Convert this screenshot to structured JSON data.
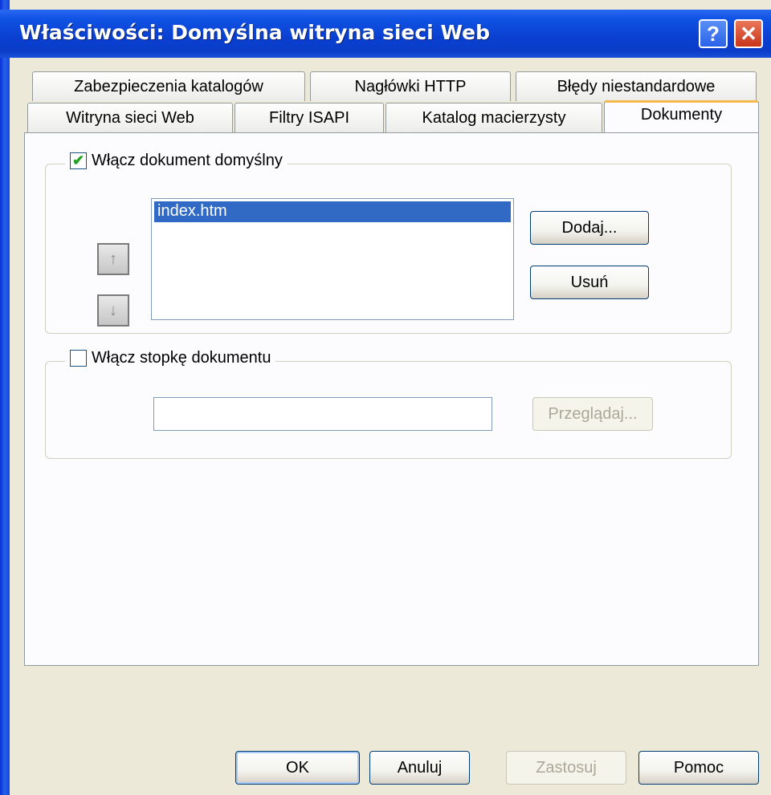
{
  "window": {
    "title": "Właściwości: Domyślna witryna sieci Web"
  },
  "titlebar_buttons": {
    "help": "?",
    "close": "✕"
  },
  "tabs_back": [
    "Zabezpieczenia katalogów",
    "Nagłówki HTTP",
    "Błędy niestandardowe"
  ],
  "tabs_front": [
    "Witryna sieci Web",
    "Filtry ISAPI",
    "Katalog macierzysty",
    "Dokumenty"
  ],
  "active_tab": "Dokumenty",
  "default_doc": {
    "enabled_label": "Włącz dokument domyślny",
    "checked": true,
    "list": [
      "index.htm"
    ],
    "selected": "index.htm",
    "add_label": "Dodaj...",
    "remove_label": "Usuń"
  },
  "footer_doc": {
    "enabled_label": "Włącz stopkę dokumentu",
    "checked": false,
    "path_value": "",
    "browse_label": "Przeglądaj..."
  },
  "buttons": {
    "ok": "OK",
    "cancel": "Anuluj",
    "apply": "Zastosuj",
    "help": "Pomoc"
  },
  "icons": {
    "move_up": "arrow-up-icon",
    "move_down": "arrow-down-icon",
    "check": "check-icon"
  },
  "colors": {
    "titlebar": "#0a3fd0",
    "selection": "#316ac5",
    "tab_highlight": "#f5b84a",
    "dialog_bg": "#ece9d8"
  }
}
